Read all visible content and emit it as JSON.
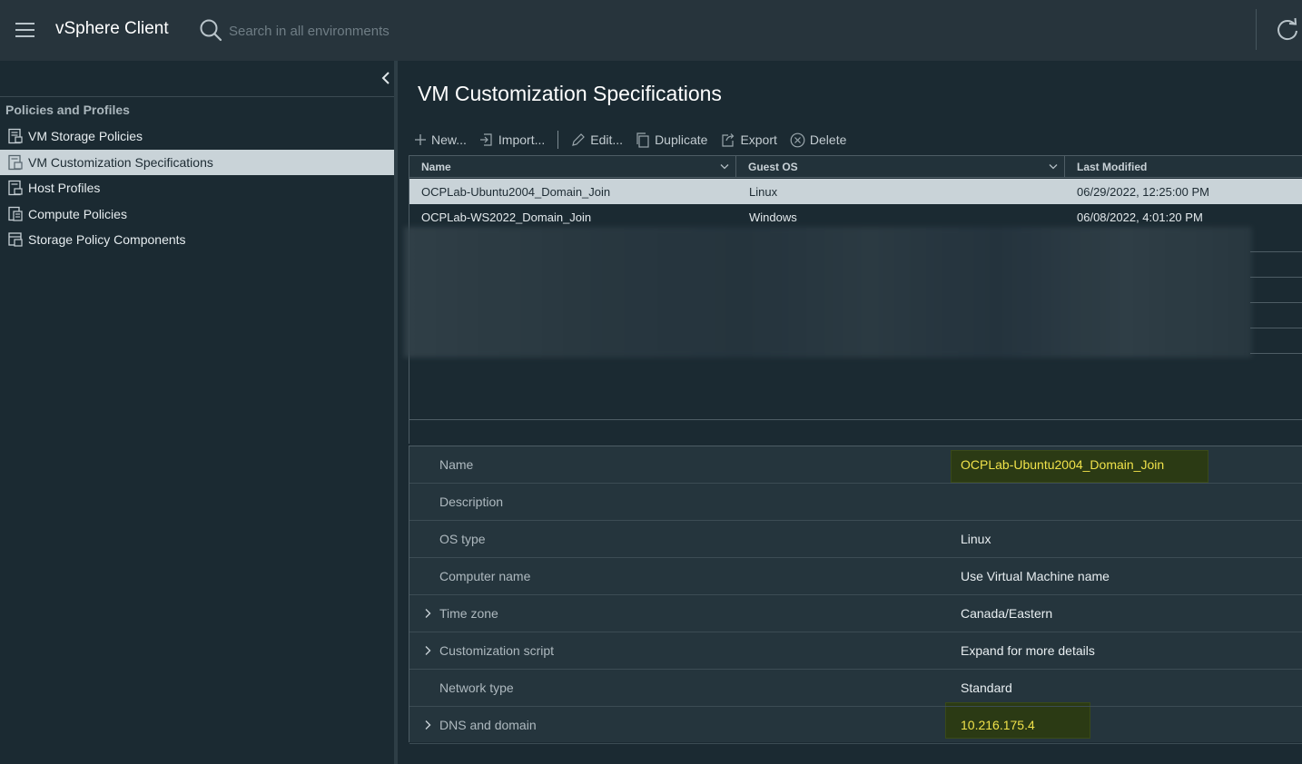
{
  "header": {
    "app_title": "vSphere Client",
    "search_placeholder": "Search in all environments"
  },
  "sidebar": {
    "heading": "Policies and Profiles",
    "items": [
      {
        "label": "VM Storage Policies",
        "icon": "storage-policy-icon",
        "selected": false
      },
      {
        "label": "VM Customization Specifications",
        "icon": "customization-spec-icon",
        "selected": true
      },
      {
        "label": "Host Profiles",
        "icon": "host-profile-icon",
        "selected": false
      },
      {
        "label": "Compute Policies",
        "icon": "compute-policy-icon",
        "selected": false
      },
      {
        "label": "Storage Policy Components",
        "icon": "storage-component-icon",
        "selected": false
      }
    ]
  },
  "main": {
    "title": "VM Customization Specifications",
    "toolbar": {
      "new": "New...",
      "import": "Import...",
      "edit": "Edit...",
      "duplicate": "Duplicate",
      "export": "Export",
      "delete": "Delete"
    },
    "grid": {
      "columns": [
        "Name",
        "Guest OS",
        "Last Modified"
      ],
      "rows": [
        {
          "name": "OCPLab-Ubuntu2004_Domain_Join",
          "guest_os": "Linux",
          "last_modified": "06/29/2022, 12:25:00 PM",
          "selected": true
        },
        {
          "name": "OCPLab-WS2022_Domain_Join",
          "guest_os": "Windows",
          "last_modified": "06/08/2022, 4:01:20 PM",
          "selected": false
        }
      ]
    },
    "details": {
      "rows": [
        {
          "label": "Name",
          "value": "OCPLab-Ubuntu2004_Domain_Join",
          "expandable": false,
          "highlight": true
        },
        {
          "label": "Description",
          "value": "",
          "expandable": false,
          "highlight": false
        },
        {
          "label": "OS type",
          "value": "Linux",
          "expandable": false,
          "highlight": false
        },
        {
          "label": "Computer name",
          "value": "Use Virtual Machine name",
          "expandable": false,
          "highlight": false
        },
        {
          "label": "Time zone",
          "value": "Canada/Eastern",
          "expandable": true,
          "highlight": false
        },
        {
          "label": "Customization script",
          "value": "Expand for more details",
          "expandable": true,
          "highlight": false
        },
        {
          "label": "Network type",
          "value": "Standard",
          "expandable": false,
          "highlight": false
        },
        {
          "label": "DNS and domain",
          "value": "10.216.175.4",
          "expandable": true,
          "highlight": true
        }
      ]
    }
  },
  "colors": {
    "header_bg": "#27343c",
    "page_bg": "#1b2a32",
    "selection_bg": "#c9d3d8",
    "highlight_text": "#f0e24a"
  }
}
